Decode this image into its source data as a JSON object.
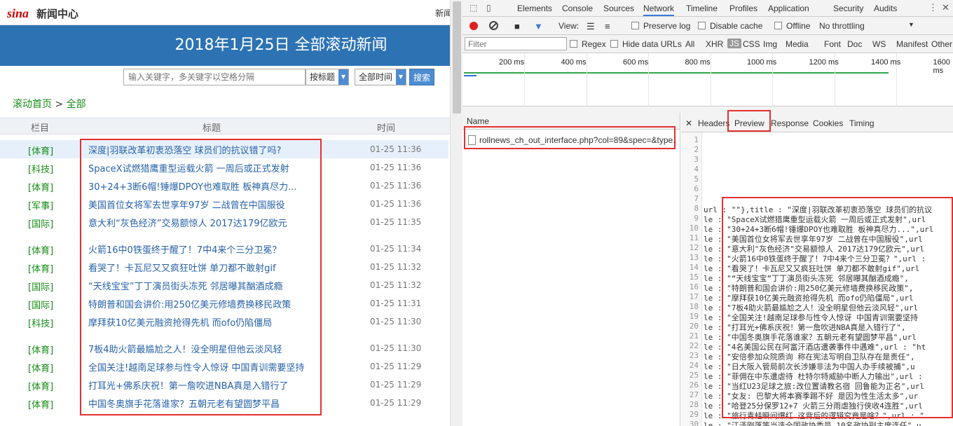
{
  "page": {
    "logo": "sina",
    "site_name": "新闻中心",
    "topbar_right": "新闻",
    "banner_title": "2018年1月25日 全部滚动新闻",
    "search": {
      "placeholder": "输入关键字，多关键字以空格分隔",
      "field_select": "按标题",
      "time_select": "全部时间",
      "button": "搜索"
    },
    "breadcrumb": {
      "home": "滚动首页",
      "sep": ">",
      "current": "全部"
    },
    "columns": {
      "category": "栏目",
      "title": "标题",
      "time": "时间"
    },
    "news": [
      {
        "cat": "[体育]",
        "title": "深度|羽联改革初衷恐落空 球员们的抗议错了吗?",
        "time": "01-25 11:36"
      },
      {
        "cat": "[科技]",
        "title": "SpaceX试燃猎鹰重型运载火箭 一周后或正式发射",
        "time": "01-25 11:36"
      },
      {
        "cat": "[体育]",
        "title": "30+24+3断6帽!锤爆DPOY也难取胜 板神真尽力...",
        "time": "01-25 11:36"
      },
      {
        "cat": "[军事]",
        "title": "美国首位女将军去世享年97岁 二战曾在中国服役",
        "time": "01-25 11:36"
      },
      {
        "cat": "[国际]",
        "title": "意大利“灰色经济”交易额惊人 2017达179亿欧元",
        "time": "01-25 11:35"
      },
      {
        "cat": "[体育]",
        "title": "火箭16中0铁蛋终于醒了！7中4来个三分卫冕？",
        "time": "01-25 11:34"
      },
      {
        "cat": "[体育]",
        "title": "看哭了！卡瓦尼又又疯狂吐饼 单刀都不敢射gif",
        "time": "01-25 11:32"
      },
      {
        "cat": "[国际]",
        "title": "“天线宝宝”丁丁演员街头冻死 邻居曝其酗酒成瘾",
        "time": "01-25 11:32"
      },
      {
        "cat": "[国际]",
        "title": "特朗普和国会讲价:用250亿美元修墙费换移民政策",
        "time": "01-25 11:31"
      },
      {
        "cat": "[科技]",
        "title": "摩拜获10亿美元融资抢得先机 而ofo仍陷僵局",
        "time": "01-25 11:30"
      },
      {
        "cat": "[体育]",
        "title": "7板4助火箭最尴尬之人！没全明星但他云淡风轻",
        "time": "01-25 11:30"
      },
      {
        "cat": "[体育]",
        "title": "全国关注!越南足球参与性令人惊讶 中国青训需要坚持",
        "time": "01-25 11:29"
      },
      {
        "cat": "[体育]",
        "title": "打耳光+佛系庆祝！第一詹吹进NBA真是入错行了",
        "time": "01-25 11:29"
      },
      {
        "cat": "[体育]",
        "title": "中国冬奥旗手花落谁家？五朝元老有望圆梦平昌",
        "time": "01-25 11:29"
      }
    ]
  },
  "devtools": {
    "tabs": [
      "Elements",
      "Console",
      "Sources",
      "Network",
      "Timeline",
      "Profiles",
      "Application",
      "Security",
      "Audits"
    ],
    "active_tab": "Network",
    "toolbar": {
      "view_label": "View:",
      "preserve_log": "Preserve log",
      "disable_cache": "Disable cache",
      "offline": "Offline",
      "throttling": "No throttling"
    },
    "filter": {
      "placeholder": "Filter",
      "regex": "Regex",
      "hide_data_urls": "Hide data URLs",
      "types": [
        "All",
        "XHR",
        "JS",
        "CSS",
        "Img",
        "Media",
        "Font",
        "Doc",
        "WS",
        "Manifest",
        "Other"
      ],
      "active_type": "JS"
    },
    "timeline_ticks": [
      "200 ms",
      "400 ms",
      "600 ms",
      "800 ms",
      "1000 ms",
      "1200 ms",
      "1400 ms",
      "1600 ms"
    ],
    "name_header": "Name",
    "request": "rollnews_ch_out_interface.php?col=89&spec=&type...",
    "detail_tabs": [
      "Headers",
      "Preview",
      "Response",
      "Cookies",
      "Timing"
    ],
    "active_detail_tab": "Preview",
    "lines": [
      {
        "n": "1",
        "t": ""
      },
      {
        "n": "2",
        "t": ""
      },
      {
        "n": "3",
        "t": ""
      },
      {
        "n": "4",
        "t": ""
      },
      {
        "n": "5",
        "t": ""
      },
      {
        "n": "6",
        "t": ""
      },
      {
        "n": "7",
        "t": ""
      },
      {
        "n": "8",
        "t": "url : \"\"},title : \"深度|羽联改革初衷恐落空 球员们的抗议"
      },
      {
        "n": "9",
        "t": "le : \"SpaceX试燃猎鹰重型运载火箭 一周后或正式发射\",url"
      },
      {
        "n": "10",
        "t": "le : \"30+24+3断6帽!锤爆DPOY也难取胜 板神真尽力...\",url"
      },
      {
        "n": "11",
        "t": "le : \"美国首位女将军去世享年97岁 二战曾在中国服役\",url"
      },
      {
        "n": "12",
        "t": "le : \"意大利\"灰色经济\"交易额惊人 2017达179亿欧元\",url"
      },
      {
        "n": "13",
        "t": "le : \"火箭16中0铁蛋终于醒了！7中4来个三分卫冕？\",url :"
      },
      {
        "n": "14",
        "t": "le : \"看哭了！卡瓦尼又又疯狂吐饼 单刀都不敢射gif\",url"
      },
      {
        "n": "15",
        "t": "le : \"“天线宝宝”丁丁演员街头冻死 邻居曝其酗酒成瘾\","
      },
      {
        "n": "16",
        "t": "le : \"特朗普和国会讲价:用250亿美元修墙费换移民政策\","
      },
      {
        "n": "17",
        "t": "le : \"摩拜获10亿美元融资抢得先机 而ofo仍陷僵局\",url"
      },
      {
        "n": "18",
        "t": "le : \"7板4助火箭最尴尬之人！没全明星但他云淡风轻\",url"
      },
      {
        "n": "19",
        "t": "le : \"全国关注!越南足球参与性令人惊讶 中国青训需要坚持"
      },
      {
        "n": "20",
        "t": "le : \"打耳光+佛系庆祝！第一詹吹进NBA真是入错行了\","
      },
      {
        "n": "21",
        "t": "le : \"中国冬奥旗手花落谁家？五朝元老有望圆梦平昌\",url"
      },
      {
        "n": "22",
        "t": "le : \"4名美国公民在阿富汗酒店遭袭事件中遇难\",url : \"ht"
      },
      {
        "n": "23",
        "t": "le : \"安倍参加众院质询 称在宪法写明自卫队存在是责任\","
      },
      {
        "n": "24",
        "t": "le : \"日大阪入管局前次长涉嫌非法为中国人办手续被捕\",u"
      },
      {
        "n": "25",
        "t": "le : \"菲佣在中东遭虐待 杜特尔特威胁中断人力输出\",url :"
      },
      {
        "n": "26",
        "t": "le : \"当红U23足球之旅:改位置请教名宿 回鲁能为正名\",url"
      },
      {
        "n": "27",
        "t": "le : \"女友: 巴黎大将本赛季踢不好 是因为性生活太多\",ur"
      },
      {
        "n": "28",
        "t": "le : \"哈登25分保罗12+7 火箭三分雨虐独行侠收4连胜\",url"
      },
      {
        "n": "29",
        "t": "le : \"旅行青蛙瞬间爆红 这背后的逻辑究竟是啥？\",url : \""
      },
      {
        "n": "30",
        "t": "le : \"江泽刚落等当选全国政协委员 10名政协副主席连任\",u"
      }
    ]
  },
  "colors": {
    "banner": "#2d73b4",
    "accent_green": "#148c14",
    "link_blue": "#2762a8",
    "highlight_red": "#e53030"
  }
}
